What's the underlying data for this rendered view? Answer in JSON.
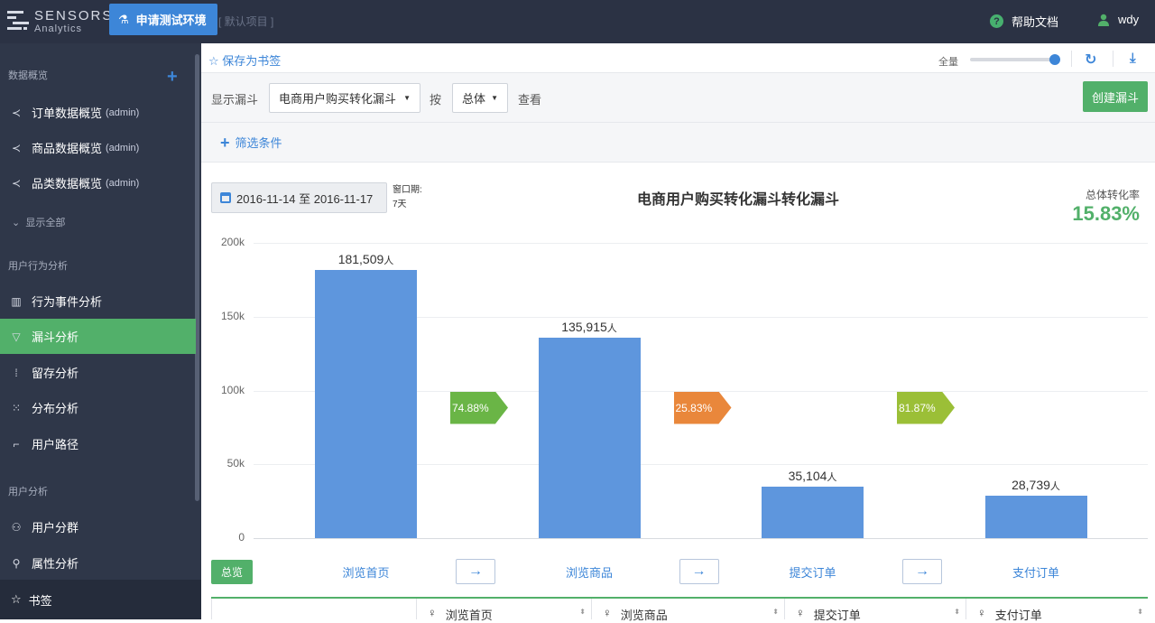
{
  "brand": {
    "name": "SENSORS",
    "sub": "Analytics"
  },
  "topbar": {
    "apply_button": "申请测试环境",
    "project": "[ 默认项目 ]",
    "help": "帮助文档",
    "user": "wdy"
  },
  "sidebar": {
    "section_overview": "数据概览",
    "overview_items": [
      {
        "label": "订单数据概览",
        "tag": "(admin)"
      },
      {
        "label": "商品数据概览",
        "tag": "(admin)"
      },
      {
        "label": "品类数据概览",
        "tag": "(admin)"
      }
    ],
    "show_all": "显示全部",
    "section_behavior": "用户行为分析",
    "behavior_items": [
      {
        "label": "行为事件分析"
      },
      {
        "label": "漏斗分析"
      },
      {
        "label": "留存分析"
      },
      {
        "label": "分布分析"
      },
      {
        "label": "用户路径"
      }
    ],
    "section_user": "用户分析",
    "user_items": [
      {
        "label": "用户分群"
      },
      {
        "label": "属性分析"
      }
    ],
    "bookmark": "书签"
  },
  "toolbar": {
    "save_bookmark": "保存为书签",
    "quantity_label": "全量",
    "quantity_level": 1.0
  },
  "controls": {
    "show_funnel_label": "显示漏斗",
    "funnel_select": "电商用户购买转化漏斗",
    "by_label": "按",
    "group_select": "总体",
    "view_label": "查看",
    "create_button": "创建漏斗",
    "filter_label": "筛选条件"
  },
  "report": {
    "date_range": "2016-11-14 至 2016-11-17",
    "window_label": "窗口期:",
    "window_value": "7天",
    "total_rate_label": "总体转化率",
    "total_rate_value": "15.83%",
    "overview_button": "总览"
  },
  "chart_data": {
    "type": "bar",
    "title": "电商用户购买转化漏斗转化漏斗",
    "categories": [
      "浏览首页",
      "浏览商品",
      "提交订单",
      "支付订单"
    ],
    "values": [
      181509,
      135915,
      35104,
      28739
    ],
    "value_labels": [
      "181,509",
      "135,915",
      "35,104",
      "28,739"
    ],
    "unit": "人",
    "conversion_rates": [
      "74.88%",
      "25.83%",
      "81.87%"
    ],
    "conversion_colors": [
      "#6ab546",
      "#e9873b",
      "#9bbf37"
    ],
    "bar_color": "#5e96dd",
    "ylim": [
      0,
      200000
    ],
    "yticks": [
      0,
      50000,
      100000,
      150000,
      200000
    ],
    "ytick_labels": [
      "0",
      "50k",
      "100k",
      "150k",
      "200k"
    ],
    "grid": true
  },
  "table": {
    "headers": [
      "浏览首页",
      "浏览商品",
      "提交订单",
      "支付订单"
    ]
  }
}
